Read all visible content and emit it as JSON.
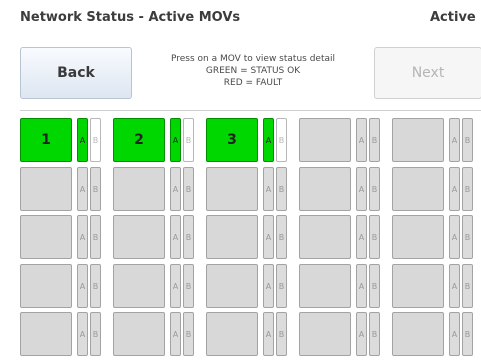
{
  "header": {
    "title": "Network Status - Active MOVs",
    "right_label": "Active"
  },
  "toolbar": {
    "back_label": "Back",
    "next_label": "Next"
  },
  "instructions": [
    "Press on a MOV to view status detail",
    "GREEN = STATUS OK",
    "RED = FAULT"
  ],
  "colors": {
    "ok_green": "#00d600",
    "inactive_gray": "#d8d8d8",
    "button_blue": "#dde6f2"
  },
  "grid": {
    "rows": [
      [
        {
          "label": "1",
          "status": "ok",
          "a": "ok",
          "b": "white"
        },
        {
          "label": "2",
          "status": "ok",
          "a": "ok",
          "b": "white"
        },
        {
          "label": "3",
          "status": "ok",
          "a": "ok",
          "b": "white"
        },
        {
          "label": "",
          "status": "inactive",
          "a": "inactive",
          "b": "inactive"
        },
        {
          "label": "",
          "status": "inactive",
          "a": "inactive",
          "b": "inactive"
        }
      ],
      [
        {
          "label": "",
          "status": "inactive",
          "a": "inactive",
          "b": "inactive"
        },
        {
          "label": "",
          "status": "inactive",
          "a": "inactive",
          "b": "inactive"
        },
        {
          "label": "",
          "status": "inactive",
          "a": "inactive",
          "b": "inactive"
        },
        {
          "label": "",
          "status": "inactive",
          "a": "inactive",
          "b": "inactive"
        },
        {
          "label": "",
          "status": "inactive",
          "a": "inactive",
          "b": "inactive"
        }
      ],
      [
        {
          "label": "",
          "status": "inactive",
          "a": "inactive",
          "b": "inactive"
        },
        {
          "label": "",
          "status": "inactive",
          "a": "inactive",
          "b": "inactive"
        },
        {
          "label": "",
          "status": "inactive",
          "a": "inactive",
          "b": "inactive"
        },
        {
          "label": "",
          "status": "inactive",
          "a": "inactive",
          "b": "inactive"
        },
        {
          "label": "",
          "status": "inactive",
          "a": "inactive",
          "b": "inactive"
        }
      ],
      [
        {
          "label": "",
          "status": "inactive",
          "a": "inactive",
          "b": "inactive"
        },
        {
          "label": "",
          "status": "inactive",
          "a": "inactive",
          "b": "inactive"
        },
        {
          "label": "",
          "status": "inactive",
          "a": "inactive",
          "b": "inactive"
        },
        {
          "label": "",
          "status": "inactive",
          "a": "inactive",
          "b": "inactive"
        },
        {
          "label": "",
          "status": "inactive",
          "a": "inactive",
          "b": "inactive"
        }
      ],
      [
        {
          "label": "",
          "status": "inactive",
          "a": "inactive",
          "b": "inactive"
        },
        {
          "label": "",
          "status": "inactive",
          "a": "inactive",
          "b": "inactive"
        },
        {
          "label": "",
          "status": "inactive",
          "a": "inactive",
          "b": "inactive"
        },
        {
          "label": "",
          "status": "inactive",
          "a": "inactive",
          "b": "inactive"
        },
        {
          "label": "",
          "status": "inactive",
          "a": "inactive",
          "b": "inactive"
        }
      ]
    ],
    "sub_a_label": "A",
    "sub_b_label": "B"
  }
}
